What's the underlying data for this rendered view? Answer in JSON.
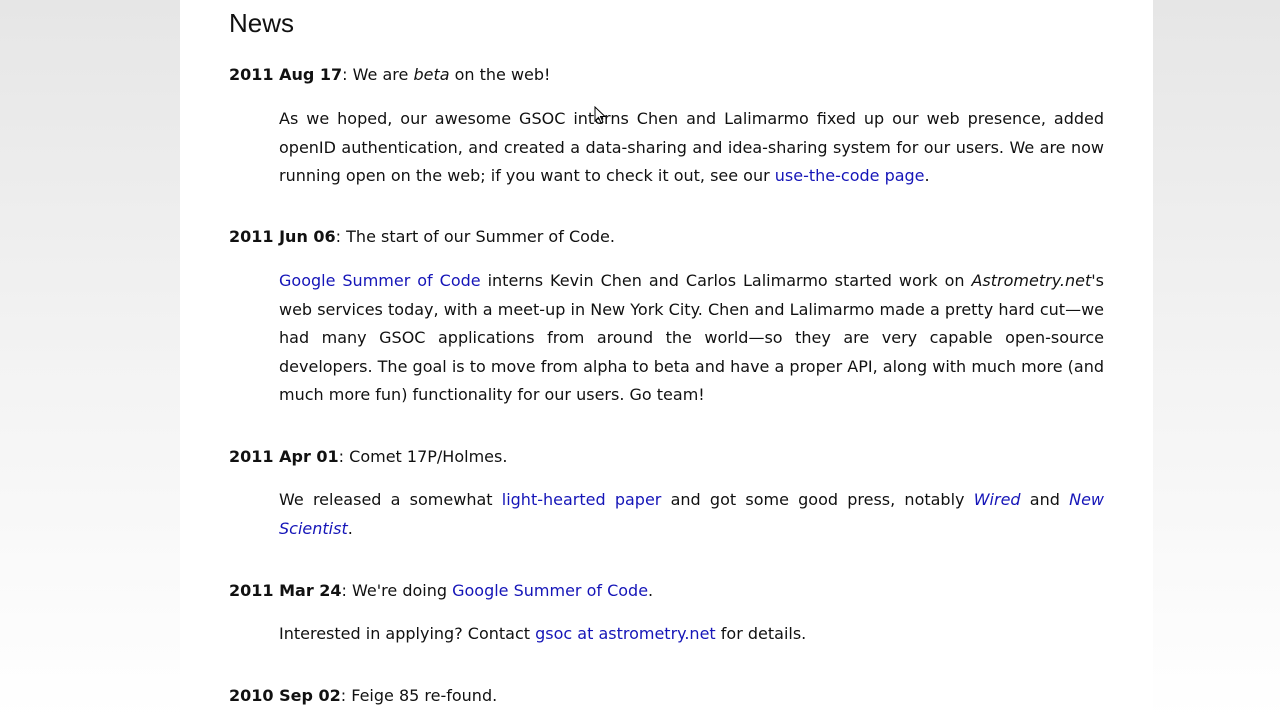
{
  "news": {
    "title": "News",
    "items": [
      {
        "date": "2011 Aug 17",
        "sep": ": ",
        "head_a": "We are ",
        "head_em": "beta",
        "head_b": " on the web!",
        "body_a": "As we hoped, our awesome GSOC interns Chen and Lalimarmo fixed up our web presence, added openID authentication, and created a data-sharing and idea-sharing system for our users. We are now running open on the web; if you want to check it out, see our ",
        "link": "use-the-code page",
        "body_b": "."
      },
      {
        "date": "2011 Jun 06",
        "sep": ": ",
        "head": "The start of our Summer of Code.",
        "link": "Google Summer of Code",
        "body_a": " interns Kevin Chen and Carlos Lalimarmo started work on ",
        "em": "Astrometry.net",
        "body_b": "'s web services today, with a meet-up in New York City. Chen and Lalimarmo made a pretty hard cut—we had many GSOC applications from around the world—so they are very capable open-source developers. The goal is to move from alpha to beta and have a proper API, along with much more (and much more fun) functionality for our users. Go team!"
      },
      {
        "date": "2011 Apr 01",
        "sep": ": ",
        "head": "Comet 17P/Holmes.",
        "body_a": "We released a somewhat ",
        "link1": "light-hearted paper",
        "body_b": " and got some good press, notably ",
        "link2": "Wired",
        "body_c": " and ",
        "link3": "New Scientist",
        "body_d": "."
      },
      {
        "date": "2011 Mar 24",
        "sep": ": ",
        "head_a": "We're doing ",
        "head_link": "Google Summer of Code",
        "head_b": ".",
        "body_a": "Interested in applying? Contact ",
        "link": "gsoc at astrometry.net",
        "body_b": " for details."
      },
      {
        "date": "2010 Sep 02",
        "sep": ": ",
        "head": "Feige 85 re-found."
      }
    ]
  },
  "colors": {
    "link": "#1515b8",
    "text": "#111111",
    "background": "#ffffff"
  },
  "icons": {
    "cursor": "mouse-pointer-icon"
  }
}
